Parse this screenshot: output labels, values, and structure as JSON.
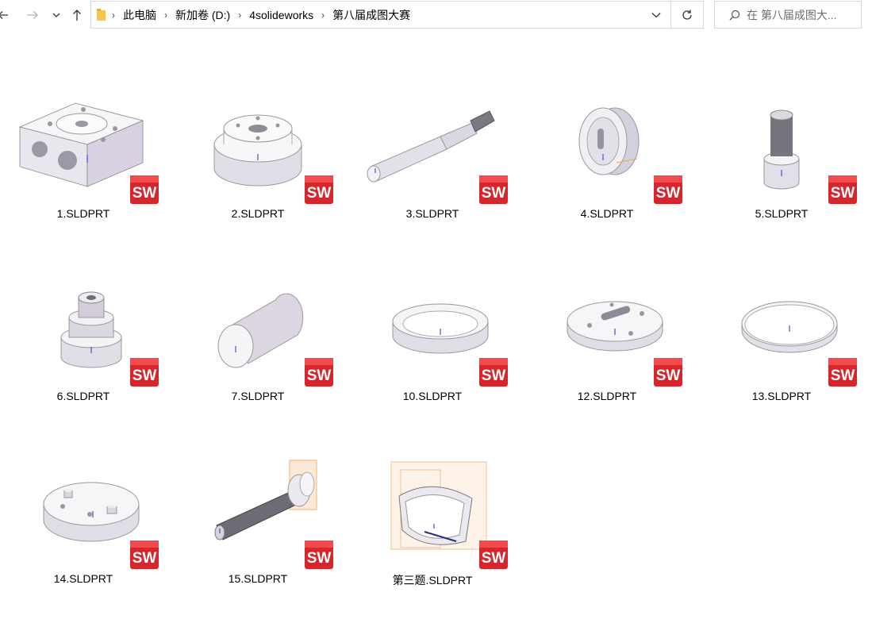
{
  "nav": {
    "back_icon": "back-arrow-icon",
    "forward_icon": "forward-arrow-icon",
    "recent_icon": "chevron-down-icon",
    "up_icon": "up-arrow-icon"
  },
  "address": {
    "crumbs": [
      "此电脑",
      "新加卷 (D:)",
      "4solideworks",
      "第八届成图大赛"
    ]
  },
  "search": {
    "placeholder": "在 第八届成图大..."
  },
  "files": [
    {
      "name": "1.SLDPRT",
      "shape": "block"
    },
    {
      "name": "2.SLDPRT",
      "shape": "flange"
    },
    {
      "name": "3.SLDPRT",
      "shape": "shaft"
    },
    {
      "name": "4.SLDPRT",
      "shape": "disc-cut"
    },
    {
      "name": "5.SLDPRT",
      "shape": "bolt-short"
    },
    {
      "name": "6.SLDPRT",
      "shape": "stepped"
    },
    {
      "name": "7.SLDPRT",
      "shape": "cylinder"
    },
    {
      "name": "10.SLDPRT",
      "shape": "ring-thick"
    },
    {
      "name": "12.SLDPRT",
      "shape": "plate-slot"
    },
    {
      "name": "13.SLDPRT",
      "shape": "ring-thin"
    },
    {
      "name": "14.SLDPRT",
      "shape": "disc-pins"
    },
    {
      "name": "15.SLDPRT",
      "shape": "screw"
    },
    {
      "name": "第三题.SLDPRT",
      "shape": "shell"
    }
  ],
  "badge": {
    "text": "SW",
    "color": "#d8252b"
  }
}
